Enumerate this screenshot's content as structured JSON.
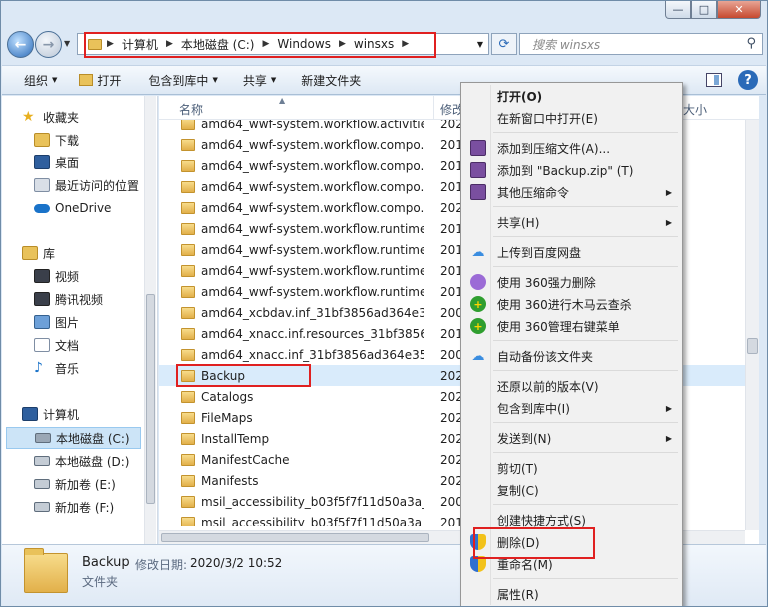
{
  "window": {
    "caption": {
      "minimize": "—",
      "maximize": "□",
      "close": "✕"
    }
  },
  "nav": {
    "breadcrumbs": [
      "计算机",
      "本地磁盘 (C:)",
      "Windows",
      "winsxs"
    ],
    "search_placeholder": "搜索 winsxs"
  },
  "toolbar": {
    "organize": "组织",
    "open": "打开",
    "include_in_library": "包含到库中",
    "share": "共享",
    "new_folder": "新建文件夹"
  },
  "sidebar": {
    "favorites": "收藏夹",
    "downloads": "下载",
    "desktop": "桌面",
    "recent": "最近访问的位置",
    "onedrive": "OneDrive",
    "libraries": "库",
    "videos": "视频",
    "tencent_video": "腾讯视频",
    "pictures": "图片",
    "documents": "文档",
    "music": "音乐",
    "computer": "计算机",
    "drives": [
      "本地磁盘 (C:)",
      "本地磁盘 (D:)",
      "新加卷 (E:)",
      "新加卷 (F:)"
    ]
  },
  "columns": {
    "name": "名称",
    "date": "修改",
    "size": "大小"
  },
  "files": [
    {
      "name": "amd64_wwf-system.workflow.activitie...",
      "date": "202"
    },
    {
      "name": "amd64_wwf-system.workflow.compo...",
      "date": "201"
    },
    {
      "name": "amd64_wwf-system.workflow.compo...",
      "date": "201"
    },
    {
      "name": "amd64_wwf-system.workflow.compo...",
      "date": "201"
    },
    {
      "name": "amd64_wwf-system.workflow.compo...",
      "date": "202"
    },
    {
      "name": "amd64_wwf-system.workflow.runtime...",
      "date": "201"
    },
    {
      "name": "amd64_wwf-system.workflow.runtime...",
      "date": "201"
    },
    {
      "name": "amd64_wwf-system.workflow.runtime...",
      "date": "201"
    },
    {
      "name": "amd64_wwf-system.workflow.runtime...",
      "date": "201"
    },
    {
      "name": "amd64_xcbdav.inf_31bf3856ad364e3...",
      "date": "200"
    },
    {
      "name": "amd64_xnacc.inf.resources_31bf3856...",
      "date": "201"
    },
    {
      "name": "amd64_xnacc.inf_31bf3856ad364e35_...",
      "date": "200"
    },
    {
      "name": "Backup",
      "date": "202"
    },
    {
      "name": "Catalogs",
      "date": "202"
    },
    {
      "name": "FileMaps",
      "date": "202"
    },
    {
      "name": "InstallTemp",
      "date": "202"
    },
    {
      "name": "ManifestCache",
      "date": "202"
    },
    {
      "name": "Manifests",
      "date": "202"
    },
    {
      "name": "msil_accessibility_b03f5f7f11d50a3a_...",
      "date": "200"
    },
    {
      "name": "msil_accessibility_b03f5f7f11d50a3a_...",
      "date": "201"
    }
  ],
  "details": {
    "name": "Backup",
    "date_label": "修改日期:",
    "date": "2020/3/2 10:52",
    "type": "文件夹"
  },
  "context_menu": {
    "open": "打开(O)",
    "open_new_window": "在新窗口中打开(E)",
    "add_to_archive": "添加到压缩文件(A)...",
    "add_to_backup_zip": "添加到 \"Backup.zip\" (T)",
    "other_compress": "其他压缩命令",
    "share": "共享(H)",
    "upload_baidu": "上传到百度网盘",
    "del_360": "使用 360强力删除",
    "scan_360": "使用 360进行木马云查杀",
    "manage_360": "使用 360管理右键菜单",
    "auto_backup": "自动备份该文件夹",
    "restore_prev": "还原以前的版本(V)",
    "include_library": "包含到库中(I)",
    "send_to": "发送到(N)",
    "cut": "剪切(T)",
    "copy": "复制(C)",
    "create_shortcut": "创建快捷方式(S)",
    "delete": "删除(D)",
    "rename": "重命名(M)",
    "properties": "属性(R)"
  },
  "colors": {
    "highlight_red": "#e02020",
    "selection_blue": "#d9ebfb",
    "folder_yellow": "#e9c25a"
  }
}
